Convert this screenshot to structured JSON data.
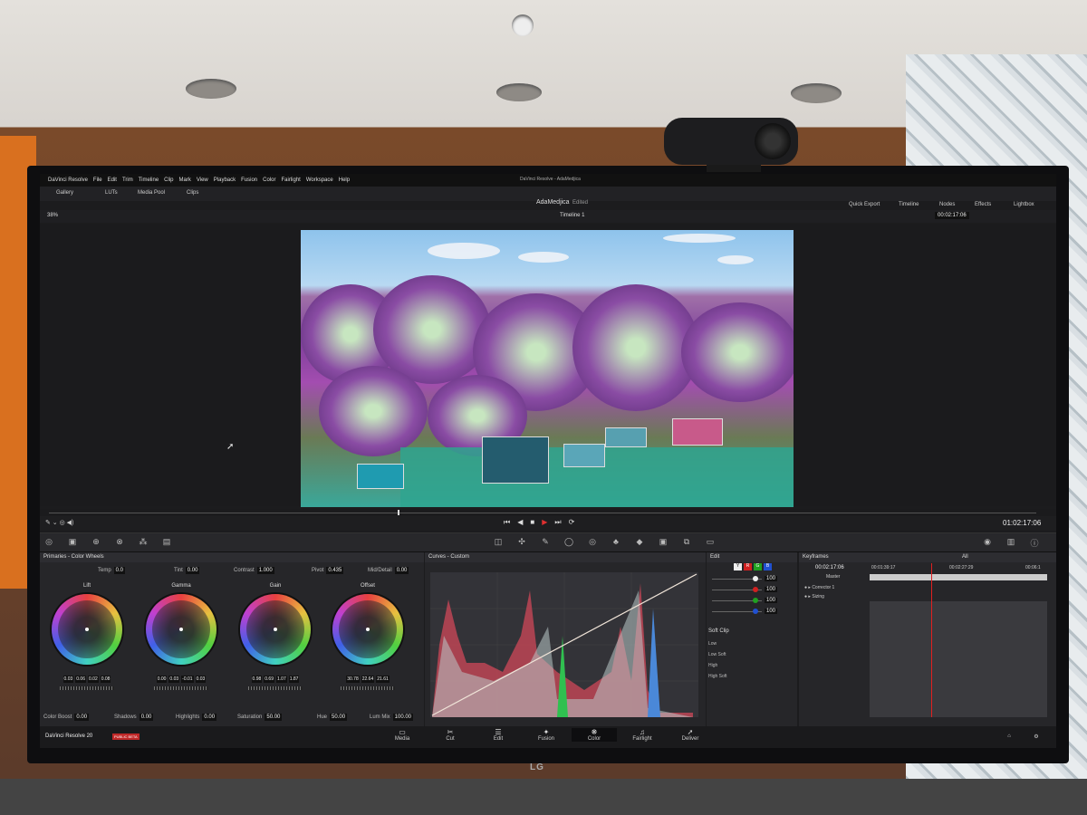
{
  "app": {
    "name": "DaVinci Resolve",
    "menu": [
      "DaVinci Resolve",
      "File",
      "Edit",
      "Trim",
      "Timeline",
      "Clip",
      "Mark",
      "View",
      "Playback",
      "Fusion",
      "Color",
      "Fairlight",
      "Workspace",
      "Help"
    ],
    "window_title": "DaVinci Resolve - AdaMedjica"
  },
  "toolbar": {
    "gallery": "Gallery",
    "luts": "LUTs",
    "media_pool": "Media Pool",
    "clips": "Clips",
    "project": "AdaMedjica",
    "status": "Edited",
    "quick_export": "Quick Export",
    "timeline": "Timeline",
    "nodes": "Nodes",
    "effects": "Effects",
    "lightbox": "Lightbox"
  },
  "subbar": {
    "zoom": "38%",
    "timeline_name": "Timeline 1",
    "timecode": "00:02:17:06"
  },
  "transport": {
    "timecode": "01:02:17:06"
  },
  "wheels_panel": {
    "title": "Primaries - Color Wheels",
    "temp_label": "Temp",
    "temp": "0.0",
    "tint_label": "Tint",
    "tint": "0.00",
    "contrast_label": "Contrast",
    "contrast": "1.000",
    "pivot_label": "Pivot",
    "pivot": "0.435",
    "middetail_label": "Mid/Detail",
    "middetail": "0.00",
    "wheels": [
      {
        "label": "Lift",
        "values": [
          "0.03",
          "0.06",
          "0.02",
          "0.08"
        ]
      },
      {
        "label": "Gamma",
        "values": [
          "0.00",
          "0.03",
          "-0.01",
          "0.03"
        ]
      },
      {
        "label": "Gain",
        "values": [
          "0.98",
          "0.69",
          "1.07",
          "1.87"
        ]
      },
      {
        "label": "Offset",
        "values": [
          "30.78",
          "22.64",
          "21.61"
        ]
      }
    ],
    "colorboost_label": "Color Boost",
    "colorboost": "0.00",
    "shadows_label": "Shadows",
    "shadows": "0.00",
    "highlights_label": "Highlights",
    "highlights": "0.00",
    "saturation_label": "Saturation",
    "saturation": "50.00",
    "hue_label": "Hue",
    "hue": "50.00",
    "lummix_label": "Lum Mix",
    "lummix": "100.00"
  },
  "curves_panel": {
    "title": "Curves - Custom"
  },
  "edit_panel": {
    "title": "Edit",
    "values": [
      "100",
      "100",
      "100",
      "100"
    ],
    "soft_clip": "Soft Clip",
    "low": "Low",
    "low_soft": "Low Soft",
    "high": "High",
    "high_soft": "High Soft"
  },
  "keyframes_panel": {
    "title": "Keyframes",
    "filter": "All",
    "timecode": "00:02:17:06",
    "ruler": [
      "00:01:39:17",
      "00:02:27:29",
      "00:06:1"
    ],
    "tracks": [
      "Master",
      "Corrector 1",
      "Sizing"
    ]
  },
  "pages": [
    "Media",
    "Cut",
    "Edit",
    "Fusion",
    "Color",
    "Fairlight",
    "Deliver"
  ],
  "active_page": "Color",
  "brand": {
    "name": "DaVinci Resolve 20",
    "badge": "PUBLIC BETA"
  },
  "monitor_brand": "LG",
  "colors": {
    "accent_red": "#e02020",
    "panel_bg": "#262629"
  }
}
